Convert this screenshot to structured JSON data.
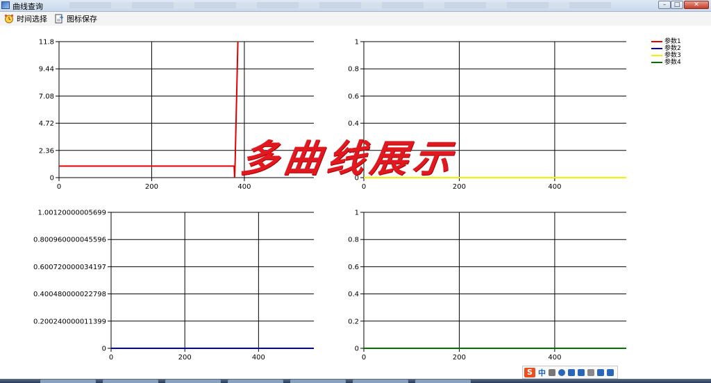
{
  "window": {
    "title": "曲线查询",
    "controls": [
      "minimize",
      "maximize",
      "close"
    ]
  },
  "toolbar": {
    "time_select_label": "时间选择",
    "save_chart_label": "图标保存",
    "time_icon": "clock-icon",
    "save_icon": "save-chart-icon"
  },
  "overlay_text": "多曲线展示",
  "legend": [
    {
      "label": "参数1",
      "color": "#e00000"
    },
    {
      "label": "参数2",
      "color": "#0000b0"
    },
    {
      "label": "参数3",
      "color": "#f0f000"
    },
    {
      "label": "参数4",
      "color": "#007000"
    }
  ],
  "chart_data": [
    {
      "type": "line",
      "position": "top-left",
      "xlim": [
        0,
        550
      ],
      "xticks": [
        "0",
        "200",
        "400"
      ],
      "ylim": [
        0,
        11.8
      ],
      "yticks": [
        "0",
        "2.36",
        "4.72",
        "7.08",
        "9.44",
        "11.8"
      ],
      "series": [
        {
          "name": "参数1",
          "color": "#e00000",
          "points": [
            [
              0,
              1
            ],
            [
              378,
              1
            ],
            [
              379,
              0
            ],
            [
              380,
              1.2
            ],
            [
              386,
              11.8
            ]
          ]
        }
      ]
    },
    {
      "type": "line",
      "position": "top-right",
      "xlim": [
        0,
        550
      ],
      "xticks": [
        "0",
        "200",
        "400"
      ],
      "ylim": [
        0,
        1
      ],
      "yticks": [
        "0",
        "0.2",
        "0.4",
        "0.6",
        "0.8",
        "1"
      ],
      "series": [
        {
          "name": "参数3",
          "color": "#f0f000",
          "points": [
            [
              0,
              0
            ],
            [
              550,
              0
            ]
          ]
        }
      ]
    },
    {
      "type": "line",
      "position": "bottom-left",
      "xlim": [
        0,
        550
      ],
      "xticks": [
        "0",
        "200",
        "400"
      ],
      "ylim": [
        0,
        1.00120000005699
      ],
      "yticks": [
        "0",
        "0.200240000011399",
        "0.400480000022798",
        "0.600720000034197",
        "0.800960000045596",
        "1.00120000005699"
      ],
      "series": [
        {
          "name": "参数2",
          "color": "#0000b0",
          "points": [
            [
              0,
              0
            ],
            [
              550,
              0
            ]
          ]
        }
      ]
    },
    {
      "type": "line",
      "position": "bottom-right",
      "xlim": [
        0,
        550
      ],
      "xticks": [
        "0",
        "200",
        "400"
      ],
      "ylim": [
        0,
        1
      ],
      "yticks": [
        "0",
        "0.2",
        "0.4",
        "0.6",
        "0.8",
        "1"
      ],
      "series": [
        {
          "name": "参数4",
          "color": "#007000",
          "points": [
            [
              0,
              0
            ],
            [
              550,
              0
            ]
          ]
        }
      ]
    }
  ],
  "ime": {
    "logo": "S",
    "mode": "中"
  }
}
